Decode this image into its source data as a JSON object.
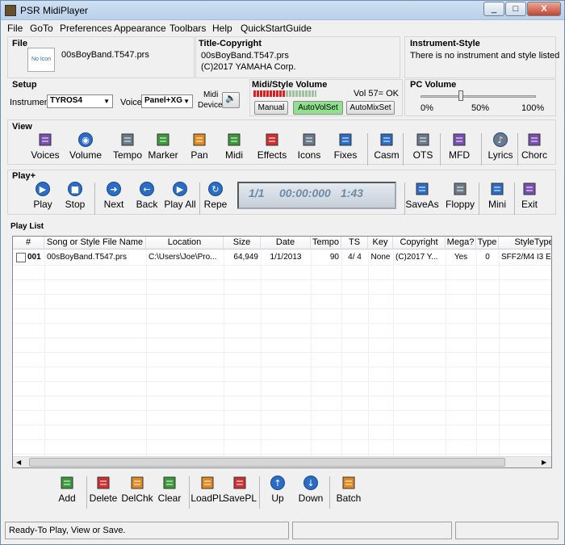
{
  "window": {
    "title": "PSR MidiPlayer",
    "min": "_",
    "max": "□",
    "close": "X"
  },
  "menu": [
    "File",
    "GoTo",
    "Preferences",
    "Appearance",
    "Toolbars",
    "Help",
    "QuickStartGuide"
  ],
  "file": {
    "label": "File",
    "noicon": "No Icon",
    "filename": "00sBoyBand.T547.prs"
  },
  "title_copyright": {
    "label": "Title-Copyright",
    "line1": "00sBoyBand.T547.prs",
    "line2": "(C)2017 YAMAHA Corp."
  },
  "instrument_style": {
    "label": "Instrument-Style",
    "text": "There is no instrument and style listed"
  },
  "setup": {
    "label": "Setup",
    "instrument_label": "Instrument",
    "instrument_value": "TYROS4",
    "voice_label": "Voice",
    "voice_value": "Panel+XG",
    "midi_device_line1": "Midi",
    "midi_device_line2": "Device"
  },
  "midi_volume": {
    "label": "Midi/Style Volume",
    "vol_text": "Vol 57= OK",
    "manual": "Manual",
    "autovolset": "AutoVolSet",
    "automixset": "AutoMixSet"
  },
  "pc_volume": {
    "label": "PC  Volume",
    "min": "0%",
    "mid": "50%",
    "max": "100%",
    "level": 0.33
  },
  "view": {
    "label": "View",
    "items": [
      "Voices",
      "Volume",
      "Tempo",
      "Marker",
      "Pan",
      "Midi",
      "Effects",
      "Icons",
      "Fixes",
      "Casm",
      "OTS",
      "MFD",
      "Lyrics",
      "Chorc"
    ]
  },
  "play": {
    "label": "Play+",
    "items": [
      "Play",
      "Stop",
      "Next",
      "Back",
      "Play All",
      "Repe",
      "SaveAs",
      "Floppy",
      "Mini",
      "Exit"
    ],
    "lcd_track": "1/1",
    "lcd_time": "00:00:000",
    "lcd_total": "1:43"
  },
  "playlist": {
    "label": "Play List",
    "columns": [
      "#",
      "Song or Style File Name",
      "Location",
      "Size",
      "Date",
      "Tempo",
      "TS",
      "Key",
      "Copyright",
      "Mega?",
      "Type",
      "StyleType/F"
    ],
    "rows": [
      [
        "001",
        "00sBoyBand.T547.prs",
        "C:\\Users\\Joe\\Pro...",
        "64,949",
        "1/1/2013",
        "90",
        "4/ 4",
        "None",
        "(C)2017 Y...",
        "Yes",
        "0",
        "SFF2/M4 I3 E"
      ]
    ]
  },
  "bottom": {
    "items": [
      "Add",
      "Delete",
      "DelChk",
      "Clear",
      "LoadPL",
      "SavePL",
      "Up",
      "Down",
      "Batch"
    ]
  },
  "statusbar": {
    "text": "Ready-To Play, View or Save."
  },
  "colors": {
    "accent": "#2b6cc4",
    "green": "#8fe08f",
    "red": "#e02020"
  }
}
